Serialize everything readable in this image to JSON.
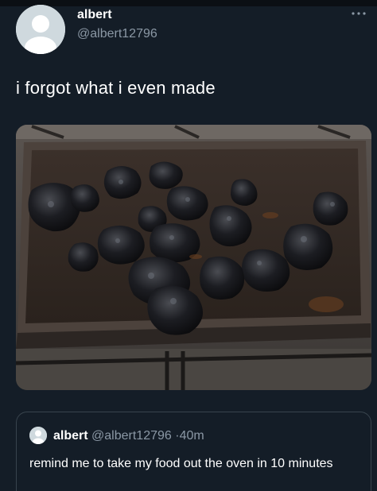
{
  "tweet": {
    "display_name": "albert",
    "handle": "@albert12796",
    "text": "i forgot what i even made",
    "more_icon": "more-dots-icon",
    "media": {
      "kind": "photo",
      "subject": "tray of burnt charred food in an oven"
    }
  },
  "quoted_tweet": {
    "display_name": "albert",
    "handle": "@albert12796",
    "separator": "·",
    "time": "40m",
    "text": "remind me to take my food out the oven in 10 minutes"
  },
  "colors": {
    "background": "#141d27",
    "secondary_text": "#8b98a5",
    "border": "#38444d",
    "avatar": "#cfd9de"
  }
}
